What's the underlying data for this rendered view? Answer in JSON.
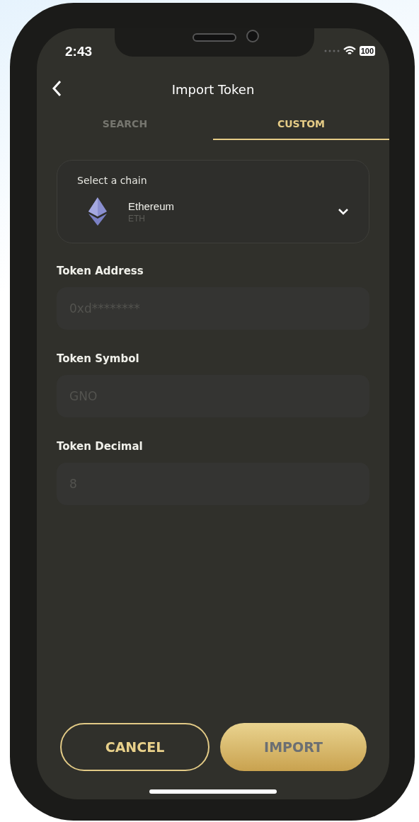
{
  "status_bar": {
    "time": "2:43",
    "battery": "100"
  },
  "header": {
    "title": "Import Token"
  },
  "tabs": [
    {
      "label": "SEARCH",
      "selected": false
    },
    {
      "label": "CUSTOM",
      "selected": true
    }
  ],
  "chain_selector": {
    "label": "Select a chain",
    "name": "Ethereum",
    "symbol": "ETH"
  },
  "fields": [
    {
      "label": "Token Address",
      "placeholder": "0xd********"
    },
    {
      "label": "Token Symbol",
      "placeholder": "GNO"
    },
    {
      "label": "Token Decimal",
      "placeholder": "8"
    }
  ],
  "buttons": [
    {
      "label": "CANCEL",
      "kind": "outline",
      "disabled": false
    },
    {
      "label": "IMPORT",
      "kind": "filled",
      "disabled": true
    }
  ]
}
